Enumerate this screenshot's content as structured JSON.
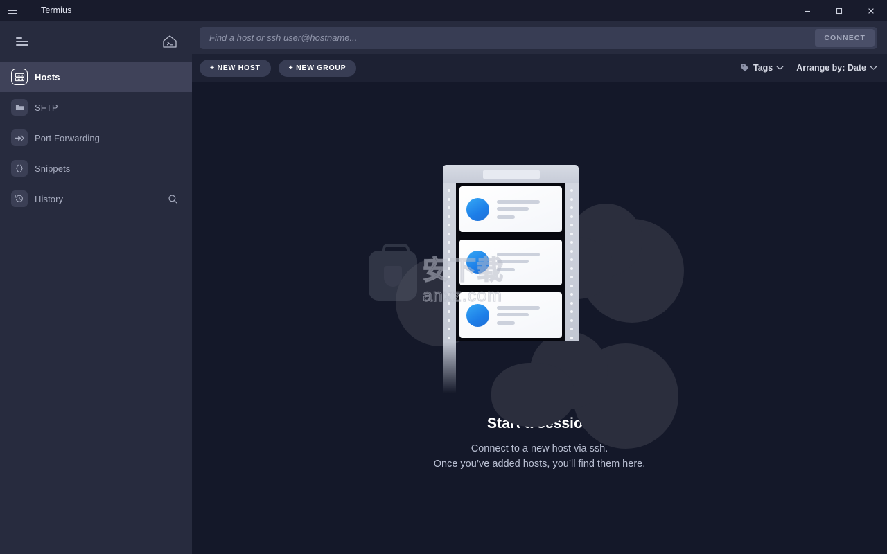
{
  "window": {
    "title": "Termius",
    "menu_icon": "hamburger-icon",
    "minimize_label": "Minimize",
    "maximize_label": "Maximize",
    "close_label": "Close"
  },
  "sidebar": {
    "sort_icon": "sort-lines-icon",
    "home_icon": "home-terminal-icon",
    "items": [
      {
        "label": "Hosts",
        "icon": "server-rack-icon",
        "active": true
      },
      {
        "label": "SFTP",
        "icon": "folder-icon",
        "active": false
      },
      {
        "label": "Port Forwarding",
        "icon": "arrow-forward-icon",
        "active": false
      },
      {
        "label": "Snippets",
        "icon": "curly-braces-icon",
        "active": false
      },
      {
        "label": "History",
        "icon": "history-clock-icon",
        "active": false,
        "trailing_icon": "search-icon"
      }
    ]
  },
  "search": {
    "placeholder": "Find a host or ssh user@hostname...",
    "value": "",
    "connect_label": "CONNECT"
  },
  "toolbar": {
    "new_host_label": "+ NEW HOST",
    "new_group_label": "+ NEW GROUP",
    "tags_label": "Tags",
    "tags_icon": "tag-icon",
    "arrange_label": "Arrange by: Date",
    "chevron_icon": "chevron-down-icon"
  },
  "empty_state": {
    "illustration": "server-rack-with-clouds-illustration",
    "title": "Start a session",
    "line1": "Connect to a new host via ssh.",
    "line2": "Once you’ve added hosts, you’ll find them here."
  },
  "watermark": {
    "cn_text": "安下载",
    "url_text": "anxz.com",
    "icon": "briefcase-shield-icon"
  },
  "colors": {
    "titlebar_bg": "#181b2c",
    "sidebar_bg": "#272b3e",
    "sidebar_active": "#3f4259",
    "main_bg": "#141829",
    "toolbar_bg": "#1d2133",
    "search_field_bg": "#383d54",
    "connect_btn_bg": "#4a4f68",
    "accent_blue": "#1d7ee8",
    "cloud": "#2b2e3d",
    "text_primary": "#ffffff",
    "text_muted": "#a8adc0"
  }
}
